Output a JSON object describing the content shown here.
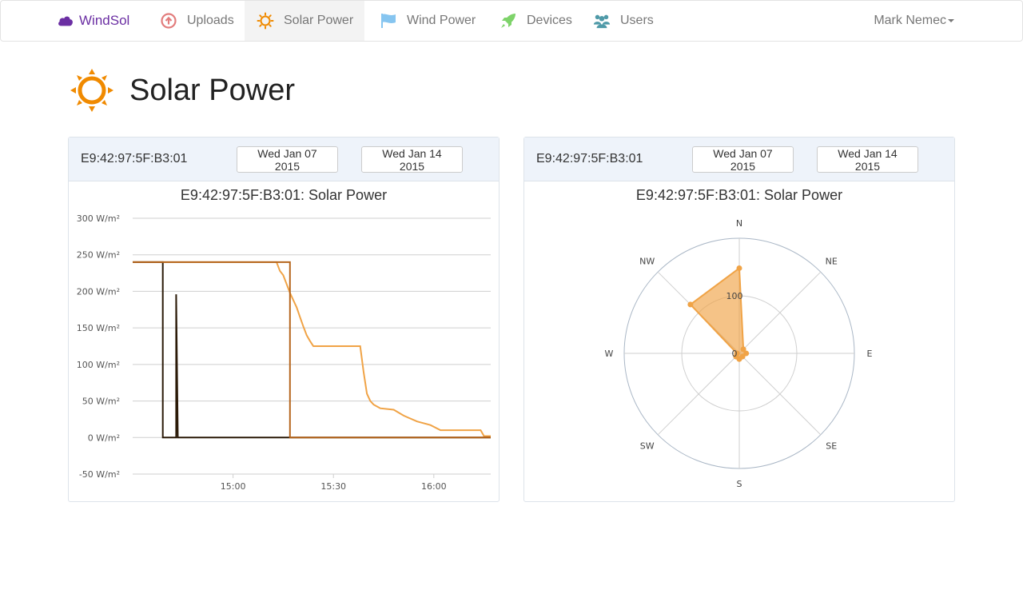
{
  "navbar": {
    "brand": "WindSol",
    "items": [
      {
        "label": "Uploads",
        "icon": "upload-icon"
      },
      {
        "label": "Solar Power",
        "icon": "sun-icon",
        "active": true
      },
      {
        "label": "Wind Power",
        "icon": "flag-icon"
      },
      {
        "label": "Devices",
        "icon": "rocket-icon"
      },
      {
        "label": "Users",
        "icon": "users-icon"
      }
    ],
    "user": "Mark Nemec"
  },
  "page": {
    "title": "Solar Power"
  },
  "colors": {
    "brand": "#6b2fa3",
    "orange": "#f0a346",
    "dark": "#2b1a08",
    "brown": "#b5651d",
    "grid": "#cfcfcf"
  },
  "panels": {
    "left": {
      "device": "E9:42:97:5F:B3:01",
      "start_date": "Wed Jan 07 2015",
      "end_date": "Wed Jan 14 2015"
    },
    "right": {
      "device": "E9:42:97:5F:B3:01",
      "start_date": "Wed Jan 07 2015",
      "end_date": "Wed Jan 14 2015"
    }
  },
  "chart_data": [
    {
      "type": "line",
      "title": "E9:42:97:5F:B3:01: Solar Power",
      "ylim": [
        -50,
        300
      ],
      "yticks": [
        -50,
        0,
        50,
        100,
        150,
        200,
        250,
        300
      ],
      "ytick_labels": [
        "-50 W/m²",
        "0 W/m²",
        "50 W/m²",
        "100 W/m²",
        "150 W/m²",
        "200 W/m²",
        "250 W/m²",
        "300 W/m²"
      ],
      "x_range_minutes": [
        870,
        977
      ],
      "xticks": [
        900,
        930,
        960
      ],
      "xtick_labels": [
        "15:00",
        "15:30",
        "16:00"
      ],
      "grid": true,
      "series": [
        {
          "color": "#f0a346",
          "points": [
            [
              870,
              240
            ],
            [
              913,
              240
            ],
            [
              914,
              228
            ],
            [
              915,
              222
            ],
            [
              916,
              210
            ],
            [
              917,
              198
            ],
            [
              918,
              188
            ],
            [
              919,
              178
            ],
            [
              920,
              165
            ],
            [
              921,
              152
            ],
            [
              922,
              140
            ],
            [
              923,
              132
            ],
            [
              924,
              125
            ],
            [
              931,
              125
            ],
            [
              938,
              125
            ],
            [
              939,
              90
            ],
            [
              940,
              60
            ],
            [
              941,
              50
            ],
            [
              942,
              45
            ],
            [
              944,
              40
            ],
            [
              948,
              38
            ],
            [
              951,
              30
            ],
            [
              955,
              22
            ],
            [
              959,
              17
            ],
            [
              962,
              10
            ],
            [
              974,
              10
            ],
            [
              975,
              2
            ],
            [
              977,
              2
            ]
          ]
        },
        {
          "color": "#2b1a08",
          "points": [
            [
              870,
              240
            ],
            [
              879,
              240
            ],
            [
              879,
              0
            ],
            [
              883,
              0
            ],
            [
              883,
              196
            ],
            [
              883.5,
              0
            ],
            [
              977,
              0
            ]
          ]
        },
        {
          "color": "#b5651d",
          "points": [
            [
              870,
              240
            ],
            [
              917,
              240
            ],
            [
              917,
              0
            ],
            [
              977,
              0
            ]
          ]
        }
      ]
    },
    {
      "type": "polar",
      "title": "E9:42:97:5F:B3:01: Solar Power",
      "directions": [
        "N",
        "NE",
        "E",
        "SE",
        "S",
        "SW",
        "W",
        "NW"
      ],
      "radial_ticks": [
        0,
        100
      ],
      "rmax": 200,
      "series": [
        {
          "color": "#f0a346",
          "values": [
            148,
            10,
            12,
            8,
            10,
            8,
            4,
            120
          ]
        }
      ]
    }
  ]
}
